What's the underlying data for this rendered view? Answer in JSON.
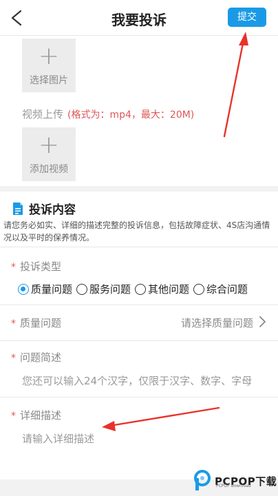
{
  "header": {
    "title": "我要投诉",
    "submit_label": "提交",
    "back_icon": "chevron-left-icon"
  },
  "upload": {
    "photo_tile": {
      "plus": "+",
      "label": "选择图片"
    },
    "video_row": {
      "label": "视频上传",
      "format_hint": "(格式为：mp4，最大：20M)"
    },
    "video_tile": {
      "plus": "+",
      "label": "添加视频"
    }
  },
  "complaint": {
    "section_title": "投诉内容",
    "section_icon": "document-icon",
    "description": "请您务必如实、详细的描述完整的投诉信息，包括故障症状、4S店沟通情况以及平时的保养情况。",
    "required_mark": "*",
    "type_field": {
      "label": "投诉类型",
      "options": [
        "质量问题",
        "服务问题",
        "其他问题",
        "综合问题"
      ],
      "selected": "质量问题"
    },
    "quality_field": {
      "label": "质量问题",
      "placeholder": "请选择质量问题"
    },
    "summary_field": {
      "label": "问题简述",
      "placeholder": "您还可以输入24个汉字，仅限于汉字、数字、字母"
    },
    "detail_field": {
      "label": "详细描述",
      "placeholder": "请输入详细描述"
    }
  },
  "watermark": {
    "text": "PCPOP下载",
    "sub": "PCPOP download"
  },
  "colors": {
    "accent": "#1a9ae6",
    "required": "#e05555",
    "annotation_arrow": "#e8322b"
  }
}
